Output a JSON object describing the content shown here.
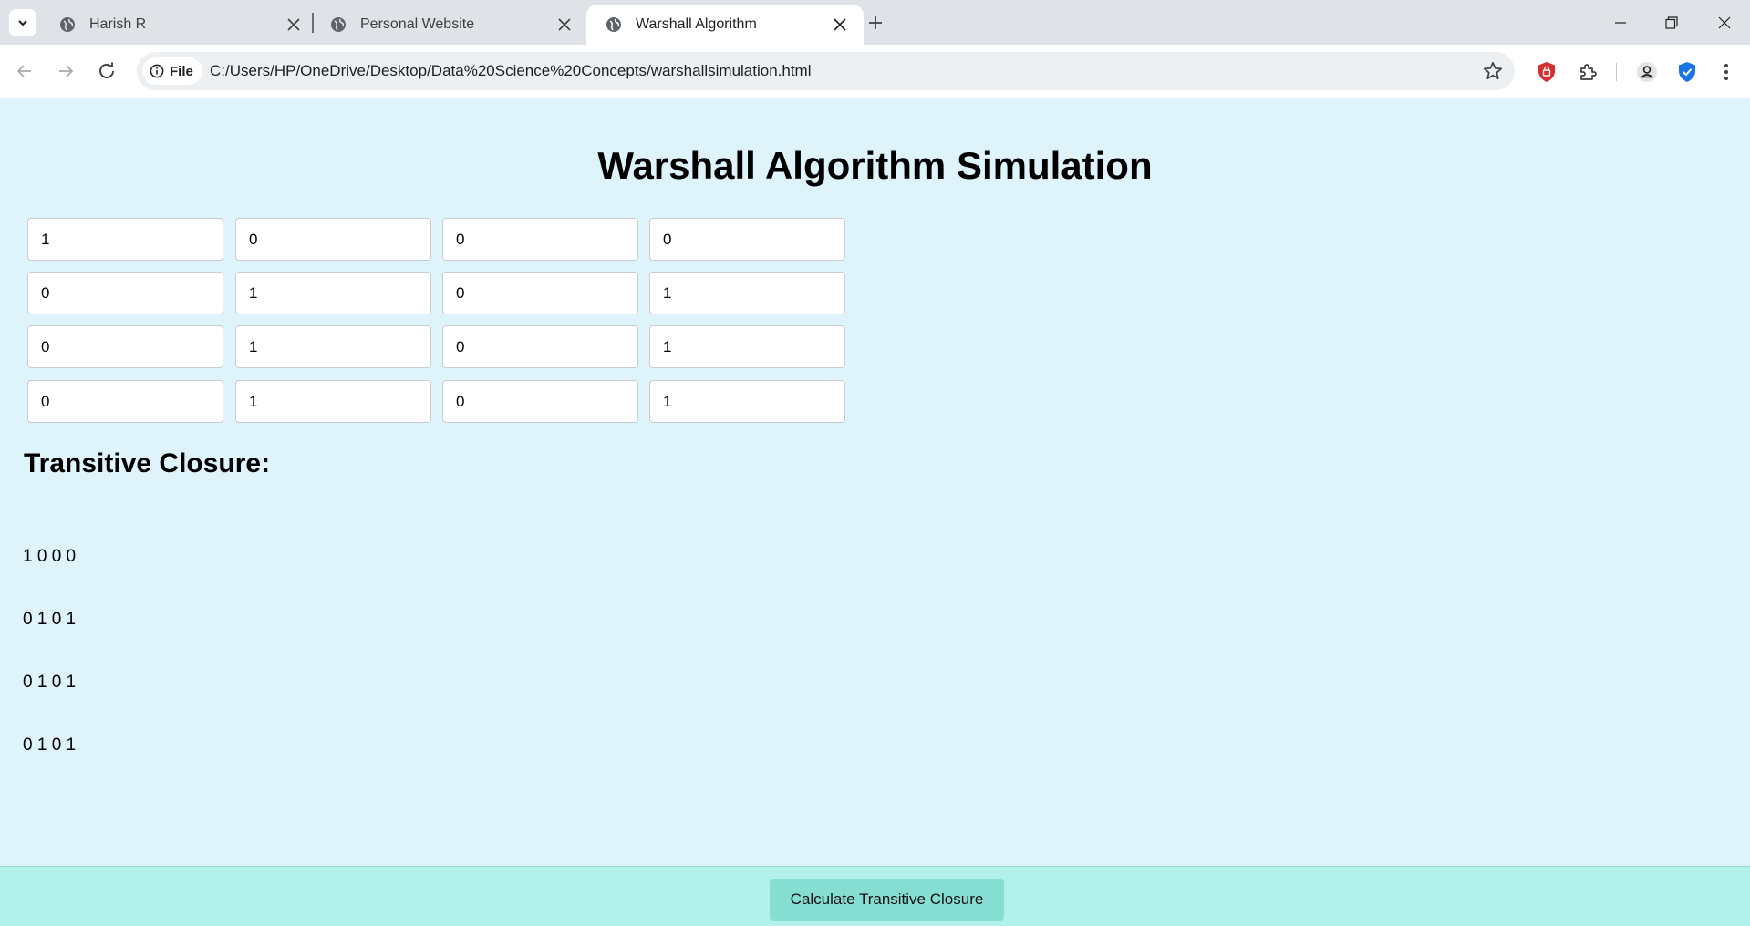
{
  "browser": {
    "tabs": [
      {
        "title": "Harish R",
        "icon": "globe-icon",
        "active": false
      },
      {
        "title": "Personal Website",
        "icon": "globe-icon",
        "active": false
      },
      {
        "title": "Warshall Algorithm",
        "icon": "globe-icon",
        "active": true
      }
    ],
    "site_chip_label": "File",
    "url": "C:/Users/HP/OneDrive/Desktop/Data%20Science%20Concepts/warshallsimulation.html"
  },
  "page": {
    "title": "Warshall Algorithm Simulation",
    "matrix": [
      [
        "1",
        "0",
        "0",
        "0"
      ],
      [
        "0",
        "1",
        "0",
        "1"
      ],
      [
        "0",
        "1",
        "0",
        "1"
      ],
      [
        "0",
        "1",
        "0",
        "1"
      ]
    ],
    "closure_heading": "Transitive Closure:",
    "closure_rows": [
      "1 0 0 0",
      "0 1 0 1",
      "0 1 0 1",
      "0 1 0 1"
    ],
    "calc_button": "Calculate Transitive Closure"
  },
  "colors": {
    "page_background": "#dff3fb",
    "footer_background": "#b2f1ea",
    "button_background": "#86ddd2"
  }
}
